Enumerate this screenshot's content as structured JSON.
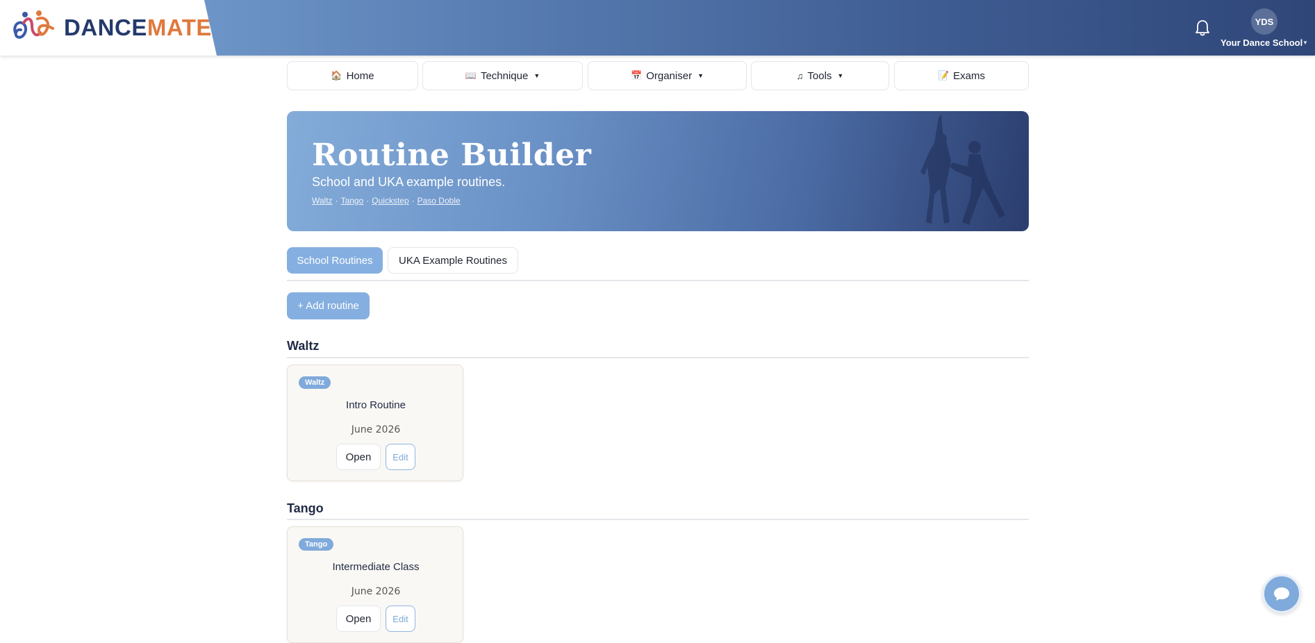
{
  "brand": {
    "part1": "DANCE",
    "part2": "MATE",
    "accent_blue": "#243a6b",
    "accent_orange": "#e0793d"
  },
  "header": {
    "avatar_initials": "YDS",
    "school_name": "Your Dance School"
  },
  "nav": {
    "home": "Home",
    "technique": "Technique",
    "organiser": "Organiser",
    "tools": "Tools",
    "exams": "Exams"
  },
  "hero": {
    "title": "Routine Builder",
    "subtitle": "School and UKA example routines.",
    "links": [
      "Waltz",
      "Tango",
      "Quickstep",
      "Paso Doble"
    ],
    "separator": "·"
  },
  "tabs": {
    "school": "School Routines",
    "uka": "UKA Example Routines"
  },
  "actions": {
    "add_routine": "+ Add routine"
  },
  "sections": [
    {
      "heading": "Waltz",
      "card": {
        "badge": "Waltz",
        "title": "Intro Routine",
        "date": "June 2026",
        "open": "Open",
        "edit": "Edit"
      }
    },
    {
      "heading": "Tango",
      "card": {
        "badge": "Tango",
        "title": "Intermediate Class",
        "date": "June 2026",
        "open": "Open",
        "edit": "Edit"
      }
    }
  ],
  "icons": {
    "home": "house-icon",
    "technique": "book-icon",
    "organiser": "calendar-icon",
    "tools": "music-note-icon",
    "exams": "memo-icon",
    "notifications": "bell-icon",
    "chat": "chat-bubble-icon"
  },
  "colors": {
    "primary_button": "#85afe0",
    "card_bg": "#faf8f4"
  }
}
